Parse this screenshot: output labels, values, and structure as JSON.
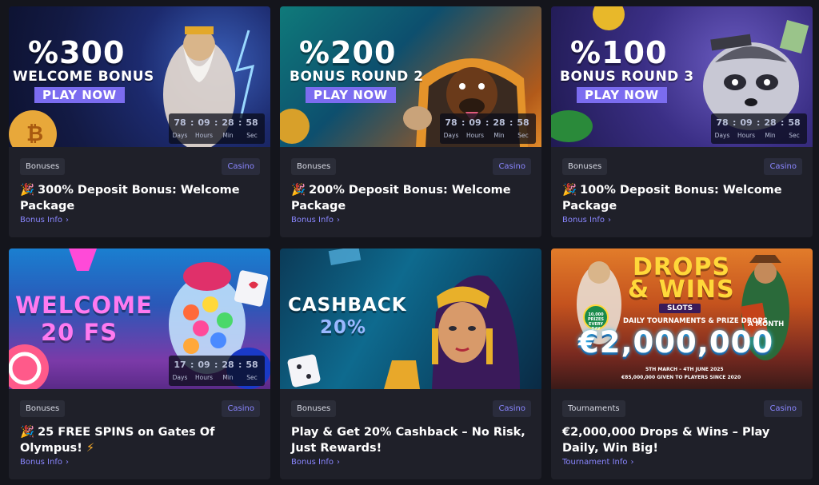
{
  "cards": [
    {
      "big": "%300",
      "sub": "WELCOME BONUS",
      "play": "PLAY NOW",
      "timer": {
        "days": "78",
        "hours": "09",
        "min": "28",
        "sec": "58",
        "sep": ":",
        "l_days": "Days",
        "l_hours": "Hours",
        "l_min": "Min",
        "l_sec": "Sec"
      },
      "tag": "Bonuses",
      "category": "Casino",
      "emoji": "🎉",
      "title": "300% Deposit Bonus: Welcome Package",
      "link": "Bonus Info",
      "chevron": "›"
    },
    {
      "big": "%200",
      "sub": "BONUS ROUND 2",
      "play": "PLAY NOW",
      "timer": {
        "days": "78",
        "hours": "09",
        "min": "28",
        "sec": "58",
        "sep": ":",
        "l_days": "Days",
        "l_hours": "Hours",
        "l_min": "Min",
        "l_sec": "Sec"
      },
      "tag": "Bonuses",
      "category": "Casino",
      "emoji": "🎉",
      "title": "200% Deposit Bonus: Welcome Package",
      "link": "Bonus Info",
      "chevron": "›"
    },
    {
      "big": "%100",
      "sub": "BONUS ROUND 3",
      "play": "PLAY NOW",
      "timer": {
        "days": "78",
        "hours": "09",
        "min": "28",
        "sec": "58",
        "sep": ":",
        "l_days": "Days",
        "l_hours": "Hours",
        "l_min": "Min",
        "l_sec": "Sec"
      },
      "tag": "Bonuses",
      "category": "Casino",
      "emoji": "🎉",
      "title": "100% Deposit Bonus: Welcome Package",
      "link": "Bonus Info",
      "chevron": "›"
    },
    {
      "big1": "WELCOME",
      "big2": "20 FS",
      "timer": {
        "days": "17",
        "hours": "09",
        "min": "28",
        "sec": "58",
        "sep": ":",
        "l_days": "Days",
        "l_hours": "Hours",
        "l_min": "Min",
        "l_sec": "Sec"
      },
      "tag": "Bonuses",
      "category": "Casino",
      "emoji": "🎉",
      "title": "25 FREE SPINS on Gates Of Olympus!",
      "title_emoji": "⚡",
      "link": "Bonus Info",
      "chevron": "›"
    },
    {
      "big1": "CASHBACK",
      "big2": "20%",
      "tag": "Bonuses",
      "category": "Casino",
      "title": "Play & Get 20% Cashback – No Risk, Just Rewards!",
      "link": "Bonus Info",
      "chevron": "›"
    },
    {
      "big1": "DROPS",
      "big2": "& WINS",
      "slots": "SLOTS",
      "tourn": "DAILY TOURNAMENTS & PRIZE DROPS",
      "prize": "€2,000,000",
      "month": "A MONTH",
      "badge": "10,000 PRIZES EVERY DAY",
      "dates": "5TH MARCH – 4TH JUNE 2025",
      "given": "€85,000,000 GIVEN TO PLAYERS SINCE 2020",
      "tag": "Tournaments",
      "category": "Casino",
      "title": "€2,000,000 Drops & Wins – Play Daily, Win Big!",
      "link": "Tournament Info",
      "chevron": "›"
    }
  ],
  "colors": {
    "page_bg": "#14151c",
    "card_bg": "#1f2029",
    "accent": "#8a86ff",
    "play_button": "#7b6cf0"
  }
}
